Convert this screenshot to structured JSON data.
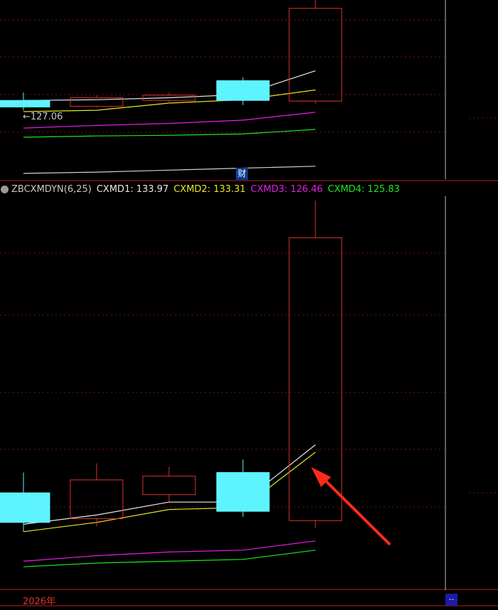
{
  "indicator": {
    "name": "ZBCXMDYN(6,25)",
    "lines": [
      {
        "label": "CXMD1",
        "value": "133.97",
        "color": "#e8e8e8"
      },
      {
        "label": "CXMD2",
        "value": "133.31",
        "color": "#e6e61e"
      },
      {
        "label": "CXMD3",
        "value": "126.46",
        "color": "#e61ee6"
      },
      {
        "label": "CXMD4",
        "value": "125.83",
        "color": "#1ee61e"
      }
    ]
  },
  "top_panel": {
    "price_label": "←127.06",
    "fin_badge": "财"
  },
  "time_axis_label": "2026年",
  "right_box_label": "--",
  "colors": {
    "up": "#e0322a",
    "down": "#5ef4ff",
    "grid": "#7a1010",
    "background": "#000000"
  },
  "chart_data": [
    {
      "type": "candlestick",
      "panel": "main",
      "candles": [
        {
          "open": 133.0,
          "high": 134.2,
          "low": 131.5,
          "close": 132.0
        },
        {
          "open": 132.1,
          "high": 133.8,
          "low": 131.9,
          "close": 133.4
        },
        {
          "open": 133.0,
          "high": 134.2,
          "low": 132.5,
          "close": 133.8
        },
        {
          "open": 136.0,
          "high": 136.5,
          "low": 132.3,
          "close": 133.0
        },
        {
          "open": 132.9,
          "high": 148.4,
          "low": 132.5,
          "close": 147.0
        }
      ],
      "series": [
        {
          "values": [
            133.0,
            133.1,
            133.4,
            133.9,
            137.5
          ],
          "color": "#e8e8e8"
        },
        {
          "values": [
            131.3,
            131.5,
            132.6,
            133.1,
            134.6
          ],
          "color": "#e6e61e"
        },
        {
          "values": [
            128.8,
            129.2,
            129.5,
            130.0,
            131.2
          ],
          "color": "#e61ee6"
        },
        {
          "values": [
            127.4,
            127.6,
            127.7,
            127.9,
            128.6
          ],
          "color": "#1ee61e"
        }
      ],
      "extra_line": {
        "values": [
          121.9,
          122.1,
          122.4,
          122.7,
          123.0
        ],
        "color": "#cfcfcf"
      }
    },
    {
      "type": "candlestick",
      "panel": "indicator",
      "candles": [
        {
          "open": 129.8,
          "high": 130.9,
          "low": 127.7,
          "close": 128.2
        },
        {
          "open": 128.4,
          "high": 131.4,
          "low": 128.0,
          "close": 130.5
        },
        {
          "open": 129.7,
          "high": 131.2,
          "low": 129.3,
          "close": 130.7
        },
        {
          "open": 130.9,
          "high": 131.6,
          "low": 128.5,
          "close": 128.8
        },
        {
          "open": 128.3,
          "high": 145.6,
          "low": 127.9,
          "close": 143.6
        }
      ],
      "series": [
        {
          "values": [
            128.1,
            128.6,
            129.3,
            129.3,
            132.4
          ],
          "color": "#e8e8e8"
        },
        {
          "values": [
            127.7,
            128.2,
            128.9,
            129.0,
            132.0
          ],
          "color": "#e6e61e"
        },
        {
          "values": [
            126.1,
            126.4,
            126.6,
            126.7,
            127.2
          ],
          "color": "#e61ee6"
        },
        {
          "values": [
            125.8,
            126.0,
            126.1,
            126.2,
            126.7
          ],
          "color": "#1ee61e"
        }
      ]
    }
  ]
}
